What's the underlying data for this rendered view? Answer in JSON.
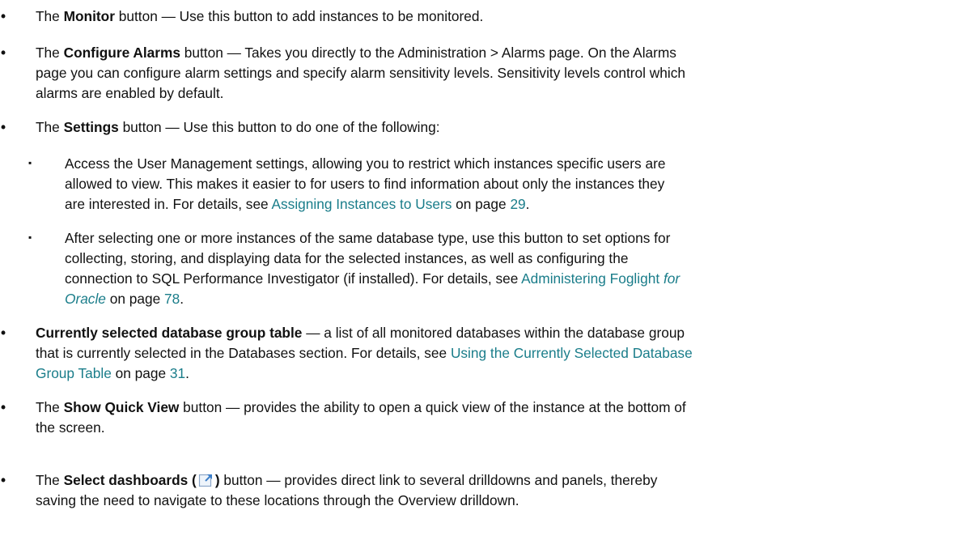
{
  "bullets": {
    "monitor": {
      "pre": "The ",
      "bold": "Monitor",
      "post": " button — Use this button to add instances to be monitored."
    },
    "alarms": {
      "pre": "The ",
      "bold": "Configure Alarms",
      "post": " button — Takes you directly to the Administration > Alarms page. On the Alarms",
      "line2": "page you can configure alarm settings and specify alarm sensitivity levels. Sensitivity levels control which",
      "line3": "alarms are enabled by default."
    },
    "settings": {
      "pre": "The ",
      "bold": "Settings",
      "post": " button — Use this button to do one of the following:"
    },
    "group_table": {
      "bold": "Currently selected database group table",
      "post": " — a list of all monitored databases within the database group",
      "line2_pre": "that is currently selected in the Databases section. For details, see ",
      "link1": "Using the Currently Selected Database",
      "link2": "Group Table",
      "mid": " on page ",
      "page": "31",
      "end": "."
    },
    "quick_view": {
      "pre": "The ",
      "bold": "Show Quick View",
      "post": " button — provides the ability to open a quick view of the instance at the bottom of",
      "line2": "the screen."
    },
    "dashboards": {
      "pre": "The ",
      "bold_a": "Select dashboards (",
      "icon": "external-link-icon",
      "bold_b": ")",
      "post": " button — provides direct link to several drilldowns and panels, thereby",
      "line2": "saving the need to navigate to these locations through the Overview drilldown."
    }
  },
  "sub": {
    "user_mgmt": {
      "line1": "Access the User Management settings, allowing you to restrict which instances specific users are",
      "line2": "allowed to view. This makes it easier to for users to find information about only the instances they",
      "line3_pre": "are interested in. For details, see ",
      "link": "Assigning Instances to Users",
      "mid": " on page ",
      "page": "29",
      "end": "."
    },
    "options": {
      "line1": "After selecting one or more instances of the same database type, use this button to set options for",
      "line2": "collecting, storing, and displaying data for the selected instances, as well as configuring the",
      "line3_pre": "connection to SQL Performance Investigator (if installed). For details, see ",
      "link": "Administering Foglight ",
      "link_italic": "for",
      "line4_link_italic": "Oracle",
      "mid": " on page ",
      "page": "78",
      "end": "."
    }
  },
  "marks": {
    "bullet": "•",
    "square": "▪"
  },
  "colors": {
    "link": "#1a7d8a",
    "text": "#111111",
    "icon_blue": "#3d7fc9"
  }
}
